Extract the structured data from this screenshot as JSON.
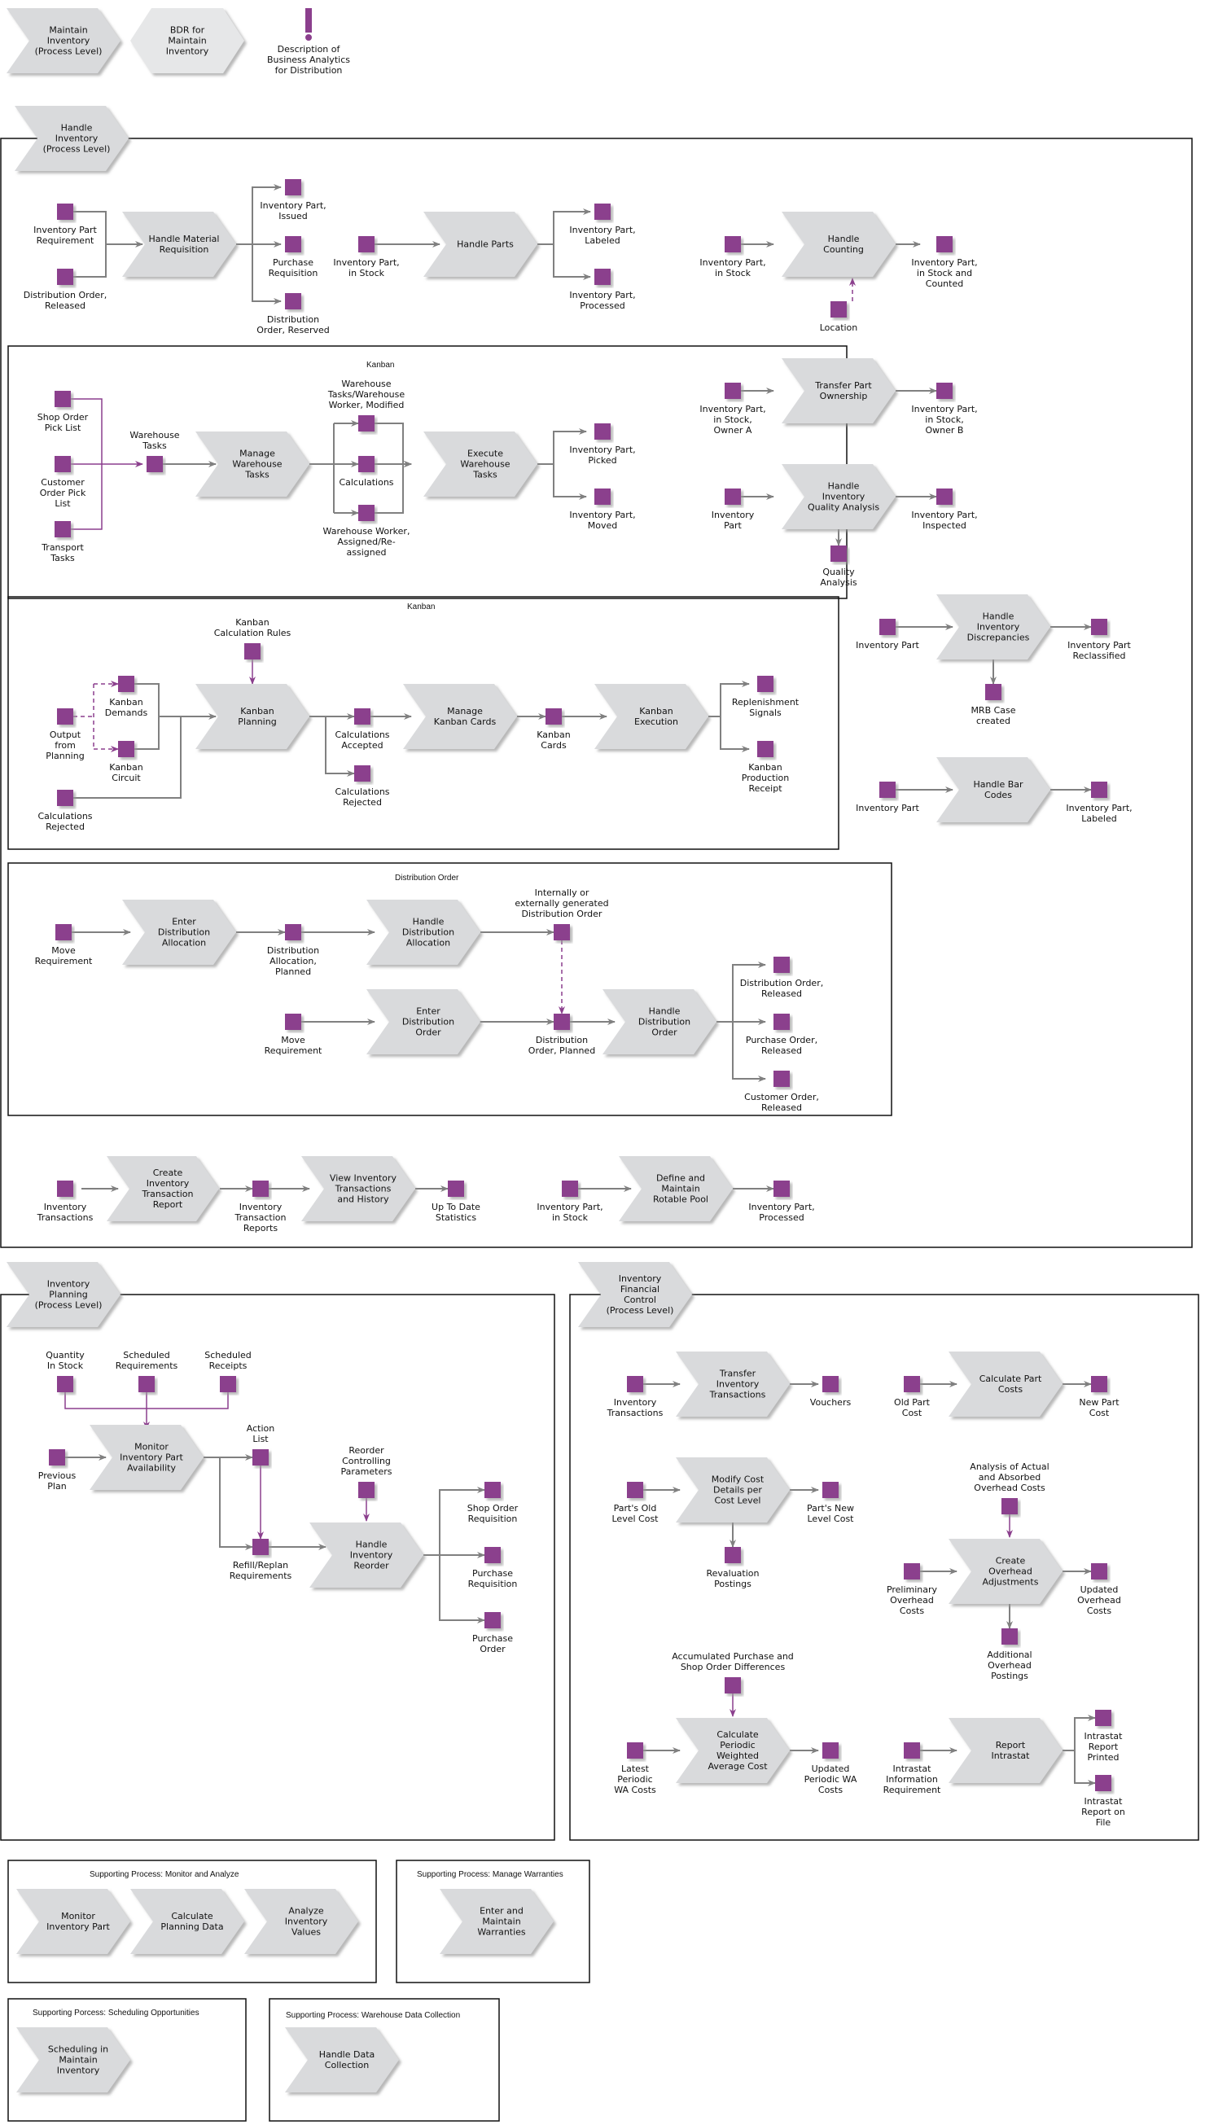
{
  "colors": {
    "object": "#8b3f8d",
    "process": "#d9dadc",
    "process_light": "#e6e7e8",
    "arrow": "#808080",
    "flow_purple": "#8b3f8d",
    "frame": "#111111"
  },
  "header": {
    "nav": [
      {
        "label": "Maintain\nInventory\n(Process Level)"
      },
      {
        "label": "BDR for\nMaintain\nInventory"
      }
    ],
    "note": {
      "icon": "exclamation-icon",
      "label": "Description of\nBusiness Analytics\nfor Distribution"
    }
  },
  "handle_inventory": {
    "title": "Handle\nInventory\n(Process Level)",
    "processes": {
      "material_requisition": "Handle Material\nRequisition",
      "handle_parts": "Handle Parts",
      "handle_counting": "Handle\nCounting",
      "transfer_ownership": "Transfer Part\nOwnership",
      "quality_analysis": "Handle\nInventory\nQuality Analysis",
      "discrepancies": "Handle\nInventory\nDiscrepancies",
      "bar_codes": "Handle Bar\nCodes",
      "manage_warehouse": "Manage\nWarehouse\nTasks",
      "execute_warehouse": "Execute\nWarehouse\nTasks",
      "kanban_planning": "Kanban\nPlanning",
      "manage_kanban": "Manage\nKanban Cards",
      "kanban_execution": "Kanban\nExecution",
      "enter_dist_alloc": "Enter\nDistribution\nAllocation",
      "handle_dist_alloc": "Handle\nDistribution\nAllocation",
      "enter_dist_order": "Enter\nDistribution\nOrder",
      "handle_dist_order": "Handle\nDistribution\nOrder",
      "create_trans_report": "Create\nInventory\nTransaction\nReport",
      "view_transactions": "View Inventory\nTransactions\nand History",
      "rotable_pool": "Define and\nMaintain\nRotable Pool"
    },
    "objects": {
      "inv_part_req": "Inventory Part\nRequirement",
      "dist_order_released_in": "Distribution Order,\nReleased",
      "inv_part_issued": "Inventory Part,\nIssued",
      "purchase_req": "Purchase\nRequisition",
      "dist_order_reserved": "Distribution\nOrder, Reserved",
      "inv_part_in_stock_1": "Inventory Part,\nin Stock",
      "inv_part_labeled": "Inventory Part,\nLabeled",
      "inv_part_processed": "Inventory Part,\nProcessed",
      "inv_part_in_stock_2": "Inventory Part,\nin Stock",
      "inv_part_counted": "Inventory Part,\nin Stock and\nCounted",
      "location": "Location",
      "owner_a": "Inventory Part,\nin Stock,\nOwner A",
      "owner_b": "Inventory Part,\nin Stock,\nOwner B",
      "inv_part_qa": "Inventory\nPart",
      "inv_part_inspected": "Inventory Part,\nInspected",
      "quality_analysis": "Quality\nAnalysis",
      "inv_part_disc": "Inventory Part",
      "reclassified": "Inventory Part\nReclassified",
      "mrb_case": "MRB Case\ncreated",
      "inv_part_bar": "Inventory Part",
      "inv_part_bar_labeled": "Inventory Part,\nLabeled",
      "shop_order_pick": "Shop Order\nPick List",
      "customer_order_pick": "Customer\nOrder Pick\nList",
      "transport_tasks": "Transport\nTasks",
      "warehouse_tasks": "Warehouse\nTasks",
      "wh_modified": "Warehouse\nTasks/Warehouse\nWorker, Modified",
      "calculations": "Calculations",
      "wh_assigned": "Warehouse Worker,\nAssigned/Re-\nassigned",
      "picked": "Inventory Part,\nPicked",
      "moved": "Inventory Part,\nMoved",
      "kanban_calc_rules": "Kanban\nCalculation Rules",
      "kanban_demands": "Kanban\nDemands",
      "output_planning": "Output\nfrom\nPlanning",
      "kanban_circuit": "Kanban\nCircuit",
      "calc_rejected_in": "Calculations\nRejected",
      "calc_accepted": "Calculations\nAccepted",
      "calc_rejected_out": "Calculations\nRejected",
      "kanban_cards": "Kanban\nCards",
      "replenishment": "Replenishment\nSignals",
      "kanban_receipt": "Kanban\nProduction\nReceipt",
      "move_req_1": "Move\nRequirement",
      "dist_alloc_planned": "Distribution\nAllocation,\nPlanned",
      "int_ext_dist_order": "Internally or\nexternally generated\nDistribution Order",
      "move_req_2": "Move\nRequirement",
      "dist_order_planned": "Distribution\nOrder, Planned",
      "dist_order_released_out": "Distribution Order,\nReleased",
      "purchase_order_released": "Purchase Order,\nReleased",
      "customer_order_released": "Customer Order,\nReleased",
      "inv_transactions": "Inventory\nTransactions",
      "inv_trans_reports": "Inventory\nTransaction\nReports",
      "up_to_date_stats": "Up To Date\nStatistics",
      "inv_part_in_stock_3": "Inventory Part,\nin Stock",
      "inv_part_processed_2": "Inventory Part,\nProcessed"
    },
    "groups": {
      "kanban_1": "Kanban",
      "kanban_2": "Kanban",
      "distribution_order": "Distribution Order"
    }
  },
  "inventory_planning": {
    "title": "Inventory\nPlanning\n(Process Level)",
    "processes": {
      "monitor": "Monitor\nInventory Part\nAvailability",
      "reorder": "Handle\nInventory\nReorder"
    },
    "objects": {
      "qty_in_stock": "Quantity\nIn Stock",
      "sched_req": "Scheduled\nRequirements",
      "sched_receipts": "Scheduled\nReceipts",
      "previous_plan": "Previous\nPlan",
      "action_list": "Action\nList",
      "reorder_params": "Reorder\nControlling\nParameters",
      "refill": "Refill/Replan\nRequirements",
      "shop_order_req": "Shop Order\nRequisition",
      "purchase_req": "Purchase\nRequisition",
      "purchase_order": "Purchase\nOrder"
    }
  },
  "financial_control": {
    "title": "Inventory\nFinancial\nControl\n(Process Level)",
    "processes": {
      "transfer": "Transfer\nInventory\nTransactions",
      "part_costs": "Calculate Part\nCosts",
      "modify_cost": "Modify Cost\nDetails per\nCost Level",
      "overhead": "Create\nOverhead\nAdjustments",
      "periodic": "Calculate\nPeriodic\nWeighted\nAverage Cost",
      "intrastat": "Report\nIntrastat"
    },
    "objects": {
      "inv_transactions": "Inventory\nTransactions",
      "vouchers": "Vouchers",
      "old_part_cost": "Old Part\nCost",
      "new_part_cost": "New Part\nCost",
      "old_level_cost": "Part's Old\nLevel Cost",
      "new_level_cost": "Part's New\nLevel Cost",
      "revaluation": "Revaluation\nPostings",
      "analysis_overhead": "Analysis of Actual\nand Absorbed\nOverhead Costs",
      "prelim_overhead": "Preliminary\nOverhead\nCosts",
      "updated_overhead": "Updated\nOverhead\nCosts",
      "additional_overhead": "Additional\nOverhead\nPostings",
      "accumulated": "Accumulated Purchase and\nShop Order Differences",
      "latest_wa": "Latest\nPeriodic\nWA Costs",
      "updated_wa": "Updated\nPeriodic WA\nCosts",
      "intrastat_req": "Intrastat\nInformation\nRequirement",
      "intrastat_printed": "Intrastat\nReport\nPrinted",
      "intrastat_file": "Intrastat\nReport on\nFile"
    }
  },
  "supporting": [
    {
      "title": "Supporting Process: Monitor and Analyze",
      "items": [
        "Monitor\nInventory Part",
        "Calculate\nPlanning Data",
        "Analyze\nInventory\nValues"
      ]
    },
    {
      "title": "Supporting Process: Manage Warranties",
      "items": [
        "Enter and\nMaintain\nWarranties"
      ]
    },
    {
      "title": "Supporting Porcess: Scheduling Opportunities",
      "items": [
        "Scheduling in\nMaintain\nInventory"
      ]
    },
    {
      "title": "Supporting Process: Warehouse Data Collection",
      "items": [
        "Handle Data\nCollection"
      ]
    }
  ]
}
